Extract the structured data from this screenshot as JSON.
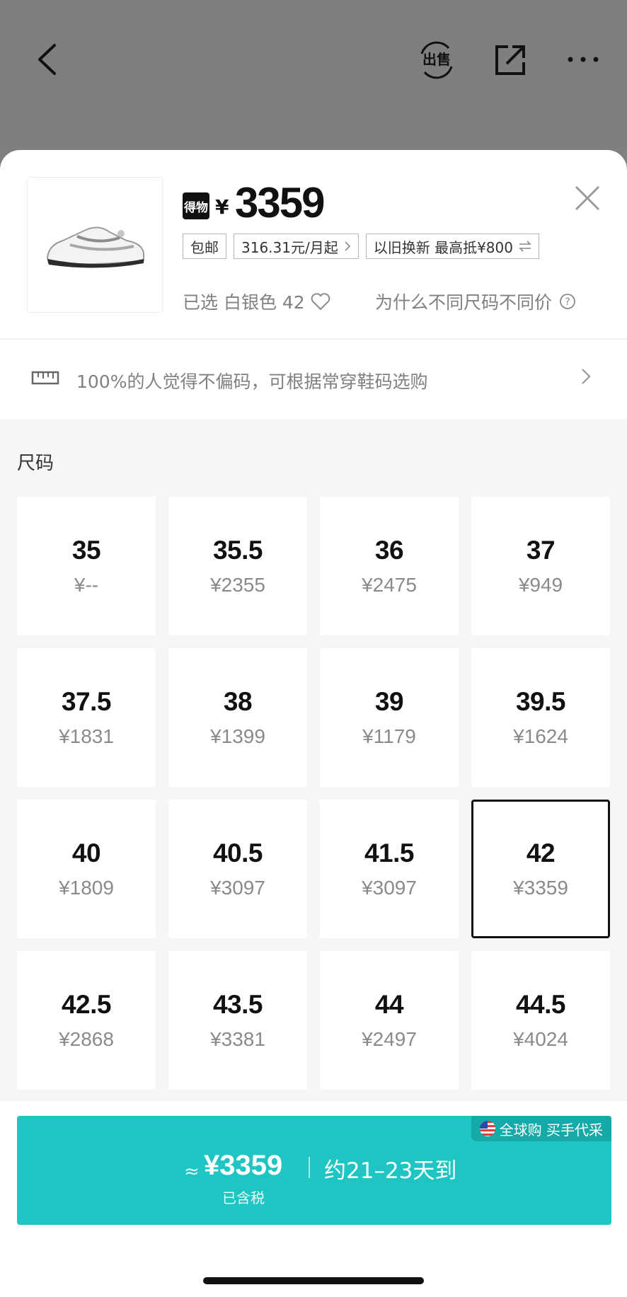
{
  "header": {
    "sell_label": "出售"
  },
  "product": {
    "brand_mark": "得物",
    "currency": "¥",
    "price": "3359",
    "tags": [
      {
        "label": "包邮"
      },
      {
        "label": "316.31元/月起"
      },
      {
        "label": "以旧换新 最高抵¥800"
      }
    ],
    "selected_text": "已选 白银色 42",
    "why_text": "为什么不同尺码不同价"
  },
  "fit": {
    "text": "100%的人觉得不偏码，可根据常穿鞋码选购"
  },
  "sizes": {
    "label": "尺码",
    "selected": "42",
    "items": [
      {
        "size": "35",
        "price": "¥--"
      },
      {
        "size": "35.5",
        "price": "¥2355"
      },
      {
        "size": "36",
        "price": "¥2475"
      },
      {
        "size": "37",
        "price": "¥949"
      },
      {
        "size": "37.5",
        "price": "¥1831"
      },
      {
        "size": "38",
        "price": "¥1399"
      },
      {
        "size": "39",
        "price": "¥1179"
      },
      {
        "size": "39.5",
        "price": "¥1624"
      },
      {
        "size": "40",
        "price": "¥1809"
      },
      {
        "size": "40.5",
        "price": "¥3097"
      },
      {
        "size": "41.5",
        "price": "¥3097"
      },
      {
        "size": "42",
        "price": "¥3359"
      },
      {
        "size": "42.5",
        "price": "¥2868"
      },
      {
        "size": "43.5",
        "price": "¥3381"
      },
      {
        "size": "44",
        "price": "¥2497"
      },
      {
        "size": "44.5",
        "price": "¥4024"
      }
    ]
  },
  "buy": {
    "badge": "全球购 买手代采",
    "approx": "≈",
    "price": "¥3359",
    "eta": "约21–23天到",
    "tax_note": "已含税"
  },
  "colors": {
    "accent": "#1fc5c2",
    "overlay": "#7f7f7f"
  }
}
